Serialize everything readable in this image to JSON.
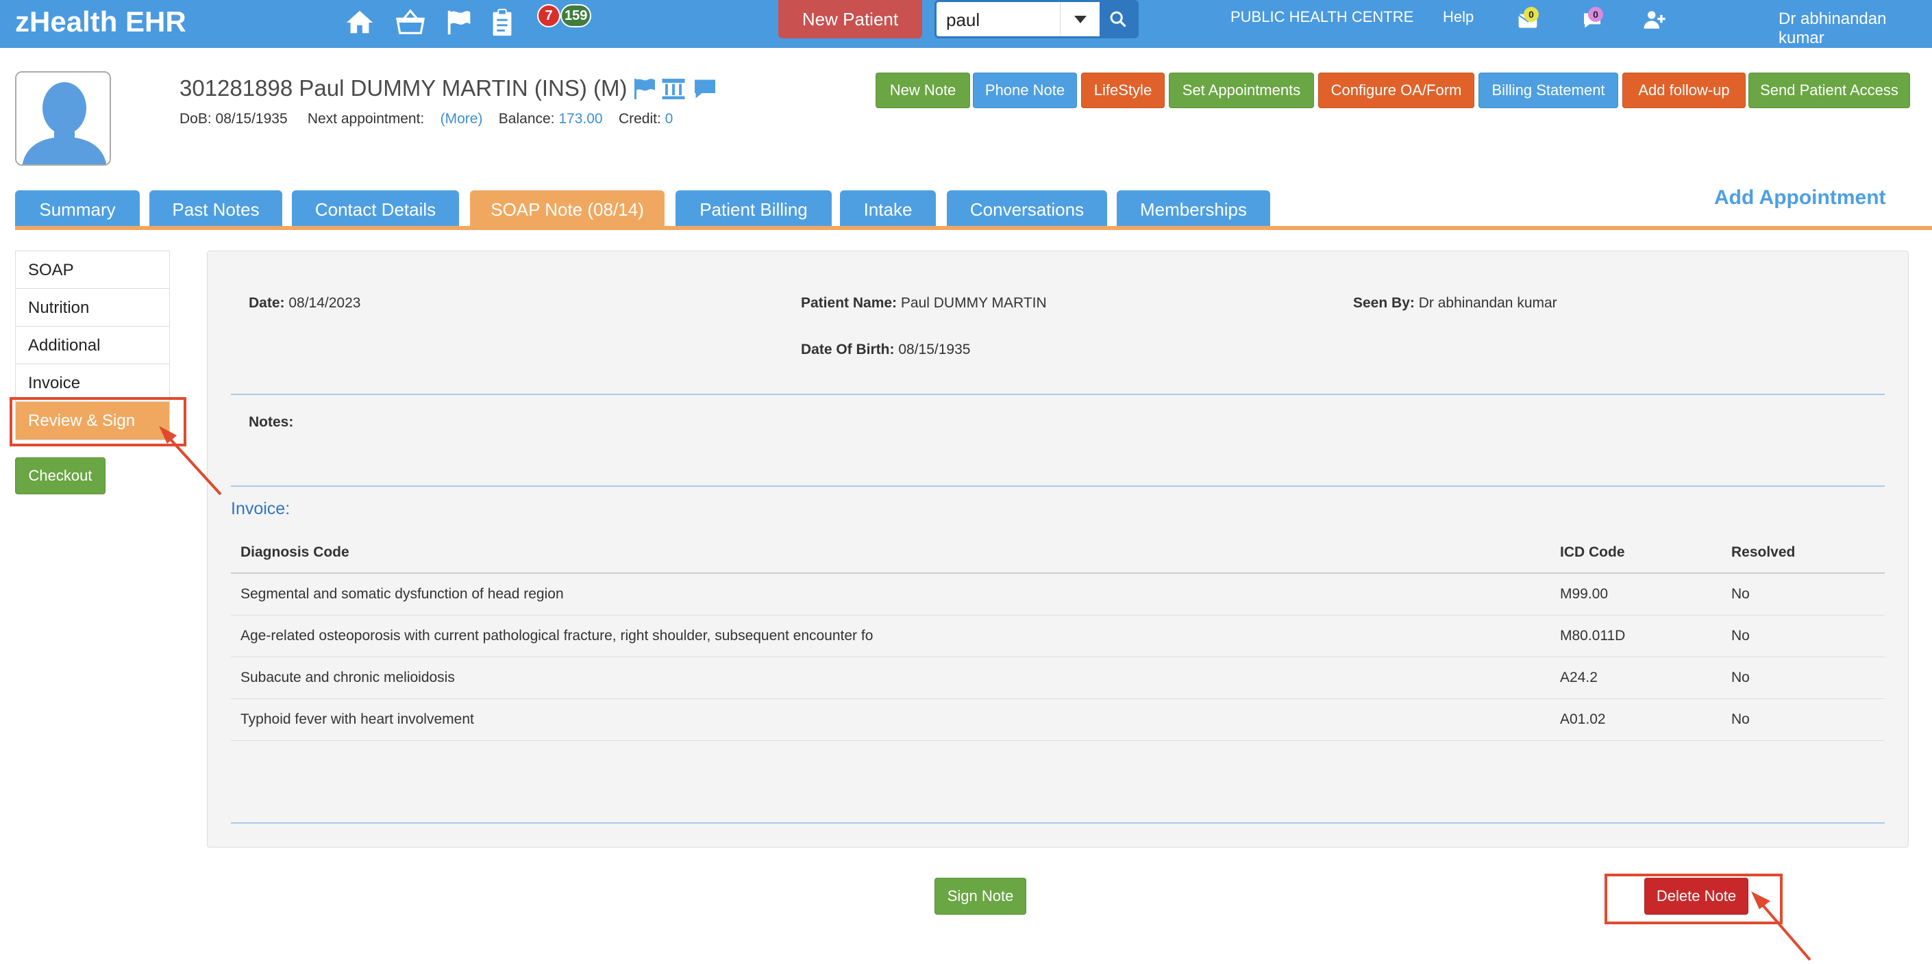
{
  "app": {
    "title": "zHealth EHR"
  },
  "topbar": {
    "badges": {
      "red": "7",
      "green": "159"
    },
    "new_patient": "New Patient",
    "search": {
      "value": "paul"
    },
    "centre": "PUBLIC HEALTH CENTRE",
    "help": "Help",
    "mail_count": "0",
    "chat_count": "0",
    "user": "Dr abhinandan kumar"
  },
  "patient": {
    "title": "301281898 Paul DUMMY MARTIN  (INS) (M)",
    "dob_label": "DoB:",
    "dob": "08/15/1935",
    "next_appt_label": "Next appointment:",
    "more": "(More)",
    "balance_label": "Balance:",
    "balance": "173.00",
    "credit_label": "Credit:",
    "credit": "0"
  },
  "actions": {
    "new_note": "New Note",
    "phone_note": "Phone Note",
    "lifestyle": "LifeStyle",
    "set_appointments": "Set Appointments",
    "configure": "Configure OA/Form",
    "billing": "Billing Statement",
    "followup": "Add follow-up",
    "send_access": "Send Patient Access"
  },
  "tabs": {
    "summary": "Summary",
    "past_notes": "Past Notes",
    "contact": "Contact Details",
    "soap": "SOAP Note (08/14)",
    "billing": "Patient Billing",
    "intake": "Intake",
    "conversations": "Conversations",
    "memberships": "Memberships",
    "add_appointment": "Add Appointment"
  },
  "sidenav": {
    "soap": "SOAP",
    "nutrition": "Nutrition",
    "additional": "Additional",
    "invoice": "Invoice",
    "review": "Review & Sign",
    "checkout": "Checkout"
  },
  "note": {
    "date_label": "Date:",
    "date": "08/14/2023",
    "patient_label": "Patient Name:",
    "patient": "Paul DUMMY MARTIN",
    "seen_label": "Seen By:",
    "seen": "Dr abhinandan kumar",
    "dob_label": "Date Of Birth:",
    "dob": "08/15/1935",
    "notes_label": "Notes:"
  },
  "invoice": {
    "heading": "Invoice:",
    "headers": {
      "diagnosis": "Diagnosis Code",
      "icd": "ICD Code",
      "resolved": "Resolved"
    },
    "rows": [
      {
        "diagnosis": "Segmental and somatic dysfunction of head region",
        "icd": "M99.00",
        "resolved": "No"
      },
      {
        "diagnosis": "Age-related osteoporosis with current pathological fracture, right shoulder, subsequent encounter fo",
        "icd": "M80.011D",
        "resolved": "No"
      },
      {
        "diagnosis": "Subacute and chronic melioidosis",
        "icd": "A24.2",
        "resolved": "No"
      },
      {
        "diagnosis": "Typhoid fever with heart involvement",
        "icd": "A01.02",
        "resolved": "No"
      }
    ]
  },
  "footer": {
    "sign": "Sign Note",
    "delete": "Delete Note"
  },
  "colors": {
    "primary": "#4e9fe2",
    "accent": "#f0a860",
    "danger": "#c8282a",
    "success": "#6aa644",
    "annotation": "#e04a2e"
  }
}
